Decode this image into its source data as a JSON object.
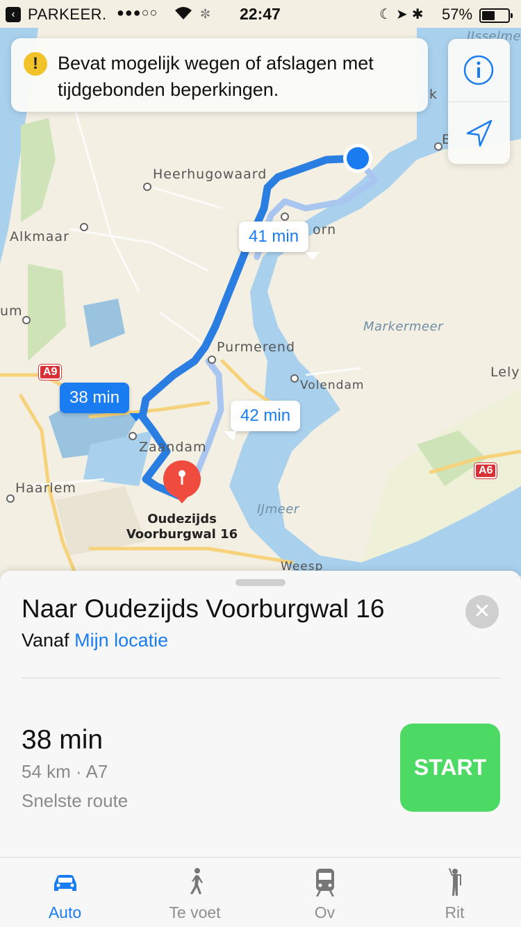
{
  "status_bar": {
    "back_app": "PARKEER.",
    "signal": "●●●○○",
    "time": "22:47",
    "battery": "57%",
    "battery_level": 0.57
  },
  "warning": {
    "icon": "exclamation-icon",
    "text": "Bevat mogelijk wegen of afslagen met tijdgebonden beperkingen."
  },
  "map_controls": {
    "info_icon": "info-icon",
    "location_icon": "location-arrow-icon"
  },
  "map": {
    "places": [
      "Heerhugowaard",
      "Alkmaar",
      "Purmerend",
      "Volendam",
      "Zaandam",
      "Haarlem",
      "Lely",
      "Weesp",
      "um",
      "orn",
      "k",
      "E"
    ],
    "water": [
      "Markermeer",
      "IJmeer",
      "IJsselmee"
    ],
    "roads": [
      "A9",
      "A6"
    ],
    "destination": [
      "Oudezijds",
      "Voorburgwal 16"
    ],
    "route_times": {
      "alt_top": "41 min",
      "main": "38 min",
      "alt_east": "42 min"
    }
  },
  "sheet": {
    "title": "Naar Oudezijds Voorburgwal 16",
    "from_prefix": "Vanaf",
    "from_link": "Mijn locatie",
    "duration": "38 min",
    "distance": "54 km · A7",
    "route_type": "Snelste route",
    "start_label": "START",
    "close_icon": "close-icon"
  },
  "tabs": [
    {
      "label": "Auto",
      "icon": "car-icon",
      "active": true
    },
    {
      "label": "Te voet",
      "icon": "walking-icon",
      "active": false
    },
    {
      "label": "Ov",
      "icon": "train-icon",
      "active": false
    },
    {
      "label": "Rit",
      "icon": "ride-icon",
      "active": false
    }
  ],
  "colors": {
    "accent": "#1a7cf1",
    "start_button": "#4cd964",
    "water": "#a9d1ee",
    "land": "#f2efe6",
    "route_main": "#2a7de1",
    "route_alt": "#a9c6f0",
    "pin": "#ef4b3e"
  }
}
